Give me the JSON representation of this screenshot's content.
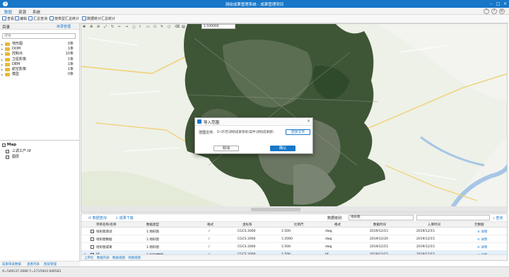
{
  "window": {
    "title": "测绘成果管理系统 - 成果管理项目",
    "logo": "S"
  },
  "menu": [
    "数据",
    "资源",
    "系统"
  ],
  "toolbar": [
    "查看",
    "编辑",
    "汇总查询",
    "按类型汇总统计",
    "数据统计汇总统计"
  ],
  "map_toolbar": {
    "scale": "1:100000"
  },
  "left_panel": {
    "title": "目录",
    "action": "目录管理",
    "search_placeholder": "搜索",
    "tree": [
      {
        "label": "地形图",
        "count": "0条"
      },
      {
        "label": "DOM",
        "count": "1条"
      },
      {
        "label": "控制点",
        "count": "10条"
      },
      {
        "label": "卫星影像",
        "count": "1条"
      },
      {
        "label": "DEM",
        "count": "1条"
      },
      {
        "label": "航空影像",
        "count": "1条"
      },
      {
        "label": "模型",
        "count": "0条"
      }
    ],
    "layers_title": "Map",
    "layers": [
      "三调工产.tif",
      "图层"
    ]
  },
  "dialog": {
    "title": "导入范围",
    "label": "范围文件:",
    "path": "D:\\示范\\测绘成果系统\\案件\\测绘成果图\\",
    "choose": "选择文件",
    "cancel": "取消",
    "ok": "确认"
  },
  "bottom_panel": {
    "btn_query": "数据查询",
    "btn_download": "成果下载",
    "scale_label": "数据级别:",
    "scale_value": "地形图",
    "search_btn": "查询",
    "columns": [
      "项目名称/名称",
      "数据类型",
      "格式",
      "坐标系",
      "比例尺",
      "格式",
      "数据时间",
      "入库时间",
      "元数据"
    ],
    "rows": [
      {
        "checked": false,
        "sel": false,
        "name": "地形图测试",
        "type": "1:地形图",
        "fmt": "/",
        "crs": "CGCS 2000",
        "scale": "1:500",
        "fmt2": "dwg",
        "date": "2019/12/15",
        "date2": "2019/12/15",
        "action": "详情"
      },
      {
        "checked": false,
        "sel": false,
        "name": "地形图数据",
        "type": "1:地形图",
        "fmt": "/",
        "crs": "CGCS 2000",
        "scale": "1:2000",
        "fmt2": "dwg",
        "date": "2019/12/20",
        "date2": "2019/12/15",
        "action": "详情"
      },
      {
        "checked": false,
        "sel": false,
        "name": "地形图成果",
        "type": "1:地形图",
        "fmt": "/",
        "crs": "CGCS 2000",
        "scale": "1:500",
        "fmt2": "dwg",
        "date": "2019/12/15",
        "date2": "2019/12/15",
        "action": "详情"
      },
      {
        "checked": true,
        "sel": true,
        "name": "tif",
        "type": "1:DOM数据",
        "fmt": "/",
        "crs": "CGCS 2000",
        "scale": "1:500",
        "fmt2": "tif",
        "date": "2019/12/15",
        "date2": "2019/12/15",
        "action": "详情"
      }
    ],
    "tabs": [
      "上传栏",
      "数据列表",
      "数据视图",
      "地图视图"
    ]
  },
  "left_tabs": [
    "成果目录数据",
    "查看列表",
    "图层管理"
  ],
  "status": "X=549137.2666 Y=2715943.946581",
  "colors": {
    "accent": "#1877c9",
    "water": "#a7c6e5"
  }
}
